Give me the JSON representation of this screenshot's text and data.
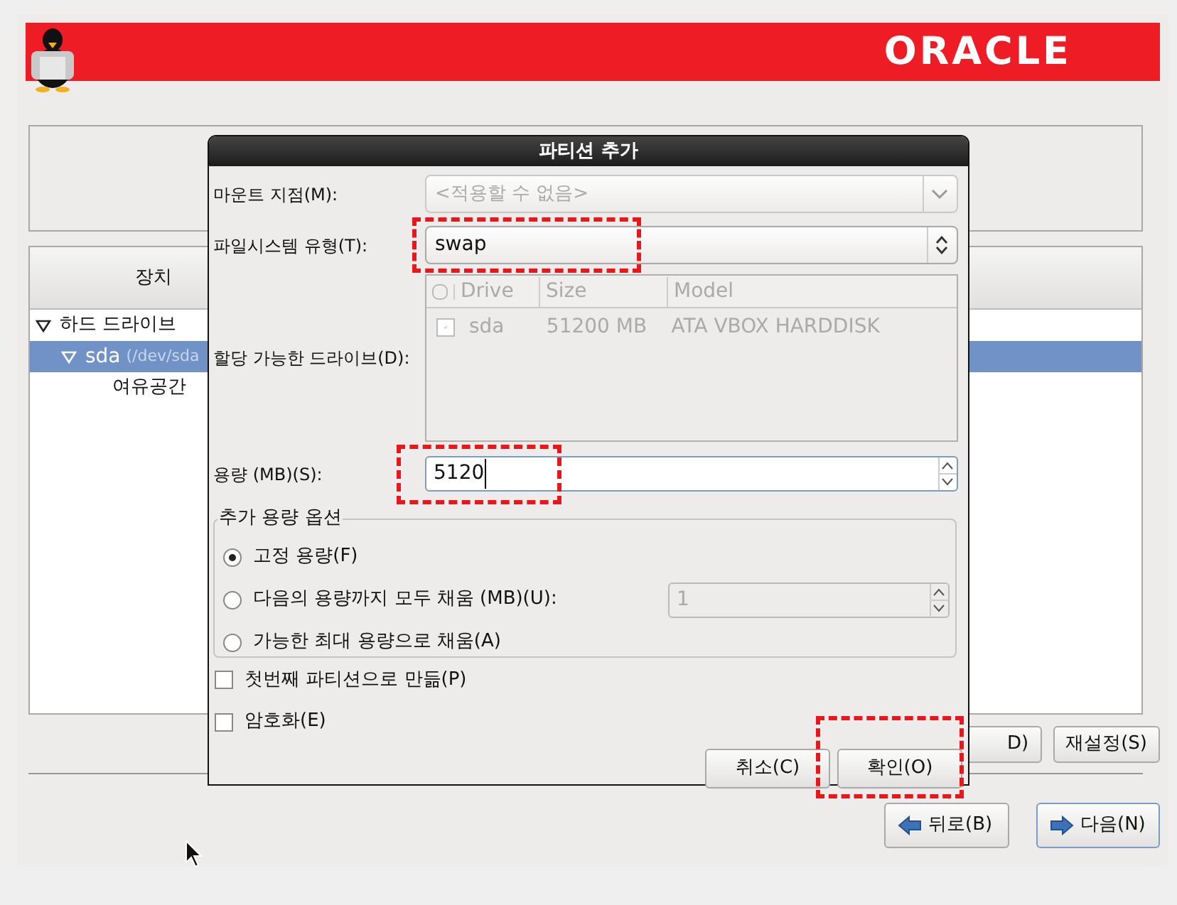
{
  "banner": {
    "logo": "ORACLE"
  },
  "device_panel": {
    "column": "장치",
    "tree": [
      {
        "label": "하드 드라이브",
        "expanded": true,
        "selected": false,
        "children": [
          {
            "label": "sda",
            "detail": "(/dev/sda",
            "expanded": true,
            "selected": true,
            "children": [
              {
                "label": "여유공간",
                "selected": false
              }
            ]
          }
        ]
      }
    ]
  },
  "panel_buttons": [
    {
      "label": "D)"
    },
    {
      "label": "재설정(S)"
    }
  ],
  "nav_buttons": [
    {
      "label": "뒤로(B)",
      "kind": "back"
    },
    {
      "label": "다음(N)",
      "kind": "next"
    }
  ],
  "dialog": {
    "title": "파티션 추가",
    "mount_point": {
      "label": "마운트 지점(M):",
      "value": "<적용할 수 없음>",
      "disabled": true
    },
    "filesystem": {
      "label": "파일시스템 유형(T):",
      "value": "swap",
      "highlighted": true
    },
    "drives": {
      "label": "할당 가능한 드라이브(D):",
      "disabled": true,
      "columns": [
        "Drive",
        "Size",
        "Model"
      ],
      "rows": [
        {
          "checked": true,
          "drive": "sda",
          "size": "51200 MB",
          "model": "ATA VBOX HARDDISK"
        }
      ]
    },
    "size": {
      "label": "용량 (MB)(S):",
      "value": "5120",
      "highlighted": true
    },
    "options": {
      "title": "추가 용량 옵션",
      "choices": [
        {
          "label": "고정 용량(F)",
          "selected": true
        },
        {
          "label": "다음의 용량까지 모두 채움 (MB)(U):",
          "selected": false,
          "field": {
            "value": "1",
            "disabled": true
          }
        },
        {
          "label": "가능한 최대 용량으로 채움(A)",
          "selected": false
        }
      ]
    },
    "checkboxes": [
      {
        "label": "첫번째 파티션으로 만듦(P)",
        "checked": false
      },
      {
        "label": "암호화(E)",
        "checked": false
      }
    ],
    "buttons": [
      {
        "label": "취소(C)",
        "highlighted": false
      },
      {
        "label": "확인(O)",
        "highlighted": true
      }
    ]
  }
}
